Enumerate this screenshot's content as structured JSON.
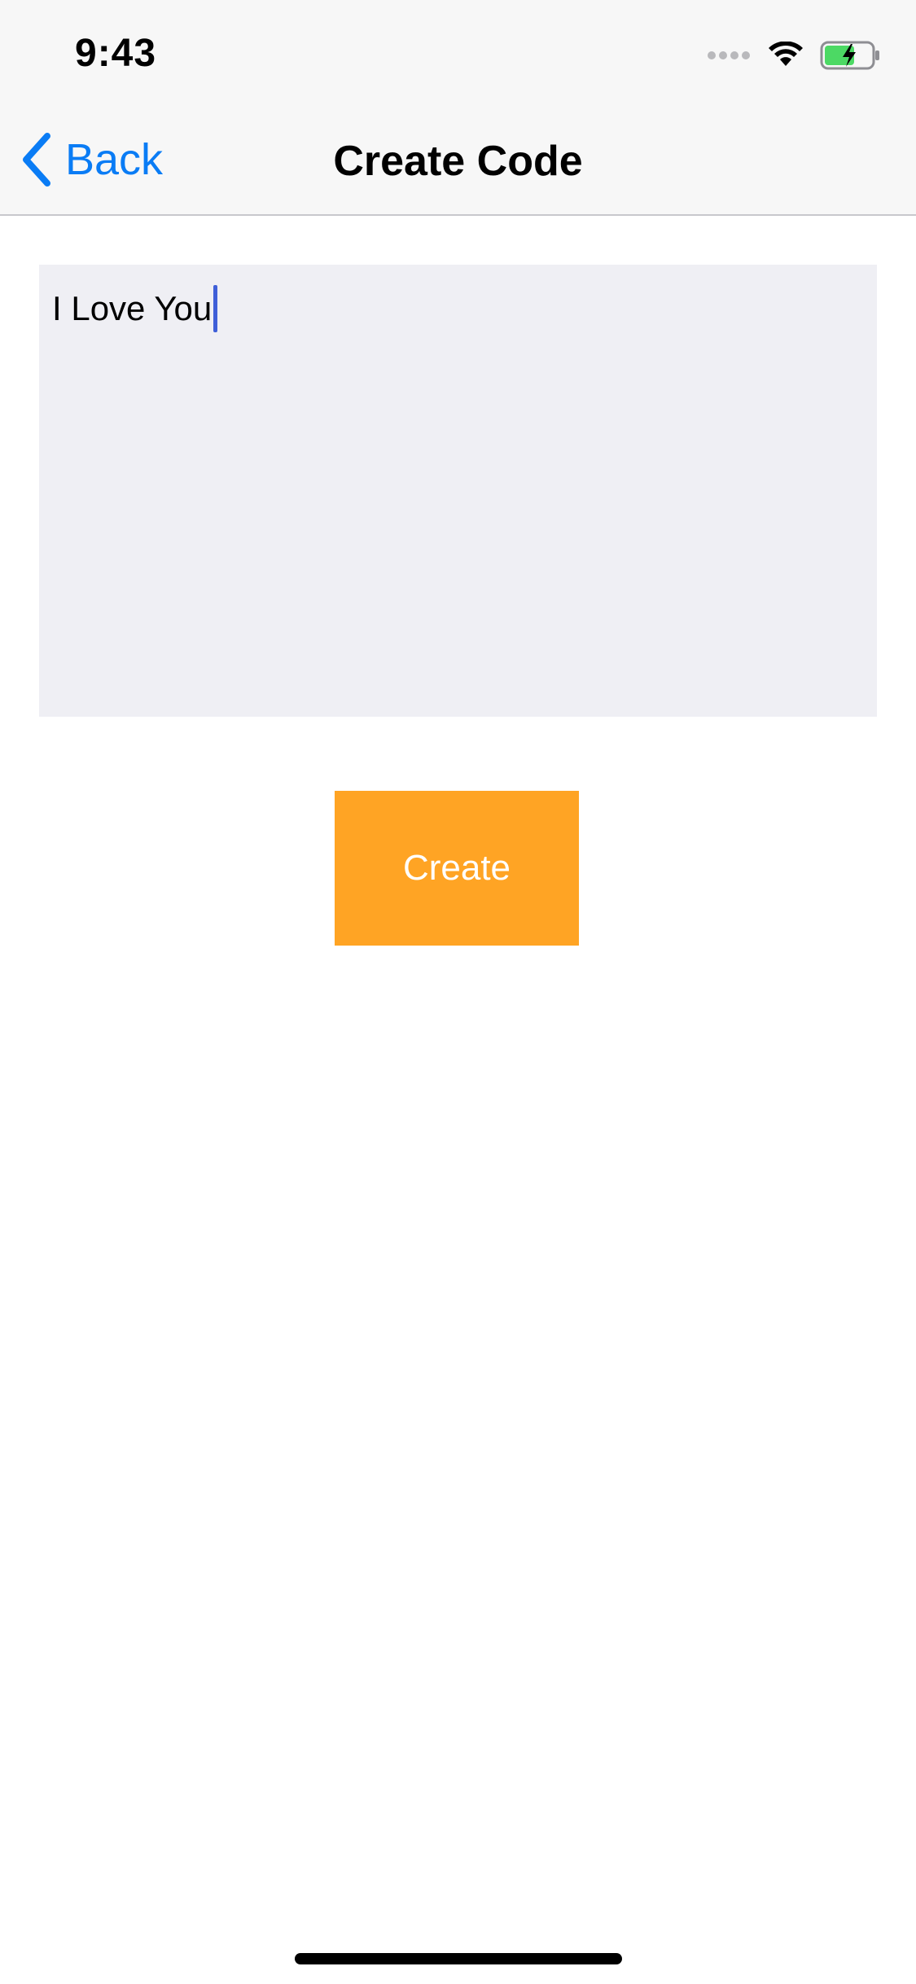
{
  "status_bar": {
    "time": "9:43",
    "icons": [
      "cellular-dots-icon",
      "wifi-icon",
      "battery-charging-icon"
    ],
    "battery_color": "#4cd964"
  },
  "nav_bar": {
    "back_label": "Back",
    "title": "Create Code",
    "accent_color": "#0a7cf5"
  },
  "editor": {
    "value": "I Love You",
    "background_color": "#efeff4",
    "caret_color": "#3f5fd8"
  },
  "create_button": {
    "label": "Create",
    "color": "#ffa424"
  }
}
